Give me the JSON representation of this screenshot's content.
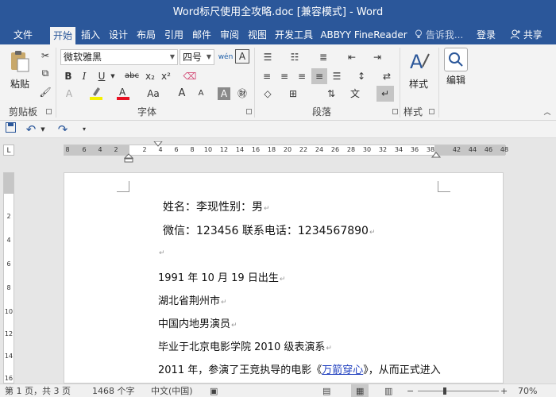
{
  "window": {
    "title": "Word标尺使用全攻略.doc [兼容模式] - Word"
  },
  "tabs": [
    "文件",
    "开始",
    "插入",
    "设计",
    "布局",
    "引用",
    "邮件",
    "审阅",
    "视图",
    "开发工具",
    "ABBYY FineReader"
  ],
  "active_tab": "开始",
  "tell_me": "告诉我...",
  "login": "登录",
  "share": "共享",
  "ribbon": {
    "clipboard": {
      "label": "剪贴板",
      "paste": "粘贴"
    },
    "font": {
      "label": "字体",
      "font_name": "微软雅黑",
      "font_size": "四号",
      "wen": "wén",
      "A_box": "A",
      "bold": "B",
      "italic": "I",
      "underline": "U",
      "strike": "abc",
      "sub": "x₂",
      "sup": "x²",
      "grow": "A",
      "shrink": "A",
      "aa": "Aa",
      "highlight_color": "#f5f100",
      "font_color": "#e81123"
    },
    "paragraph": {
      "label": "段落"
    },
    "styles": {
      "label": "样式",
      "name": "样式"
    },
    "editing": {
      "name": "编辑"
    }
  },
  "ruler": {
    "ticks_left": [
      "8",
      "6",
      "4",
      "2"
    ],
    "ticks_main": [
      "2",
      "4",
      "6",
      "8",
      "10",
      "12",
      "14",
      "16",
      "18",
      "20",
      "22",
      "24",
      "26",
      "28",
      "30",
      "32",
      "34",
      "36",
      "38"
    ],
    "ticks_right": [
      "42",
      "44",
      "46",
      "48"
    ],
    "vticks": [
      "2",
      "4",
      "6",
      "8",
      "10",
      "12",
      "14",
      "16"
    ]
  },
  "document": {
    "line1": "姓名：李现性别：男",
    "line2": "微信：123456 联系电话：1234567890",
    "line4": "1991 年 10 月 19 日出生",
    "line5": "湖北省荆州市",
    "line6": "中国内地男演员",
    "line7": "毕业于北京电影学院 2010 级表演系",
    "line8_pre": "2011 年，参演了王竞执导的电影《",
    "line8_link": "万箭穿心",
    "line8_post": "》，从而正式进入",
    "pilcrow": "↵"
  },
  "status": {
    "page": "第 1 页，共 3 页",
    "words": "1468 个字",
    "lang": "中文(中国)",
    "zoom": "70%"
  }
}
